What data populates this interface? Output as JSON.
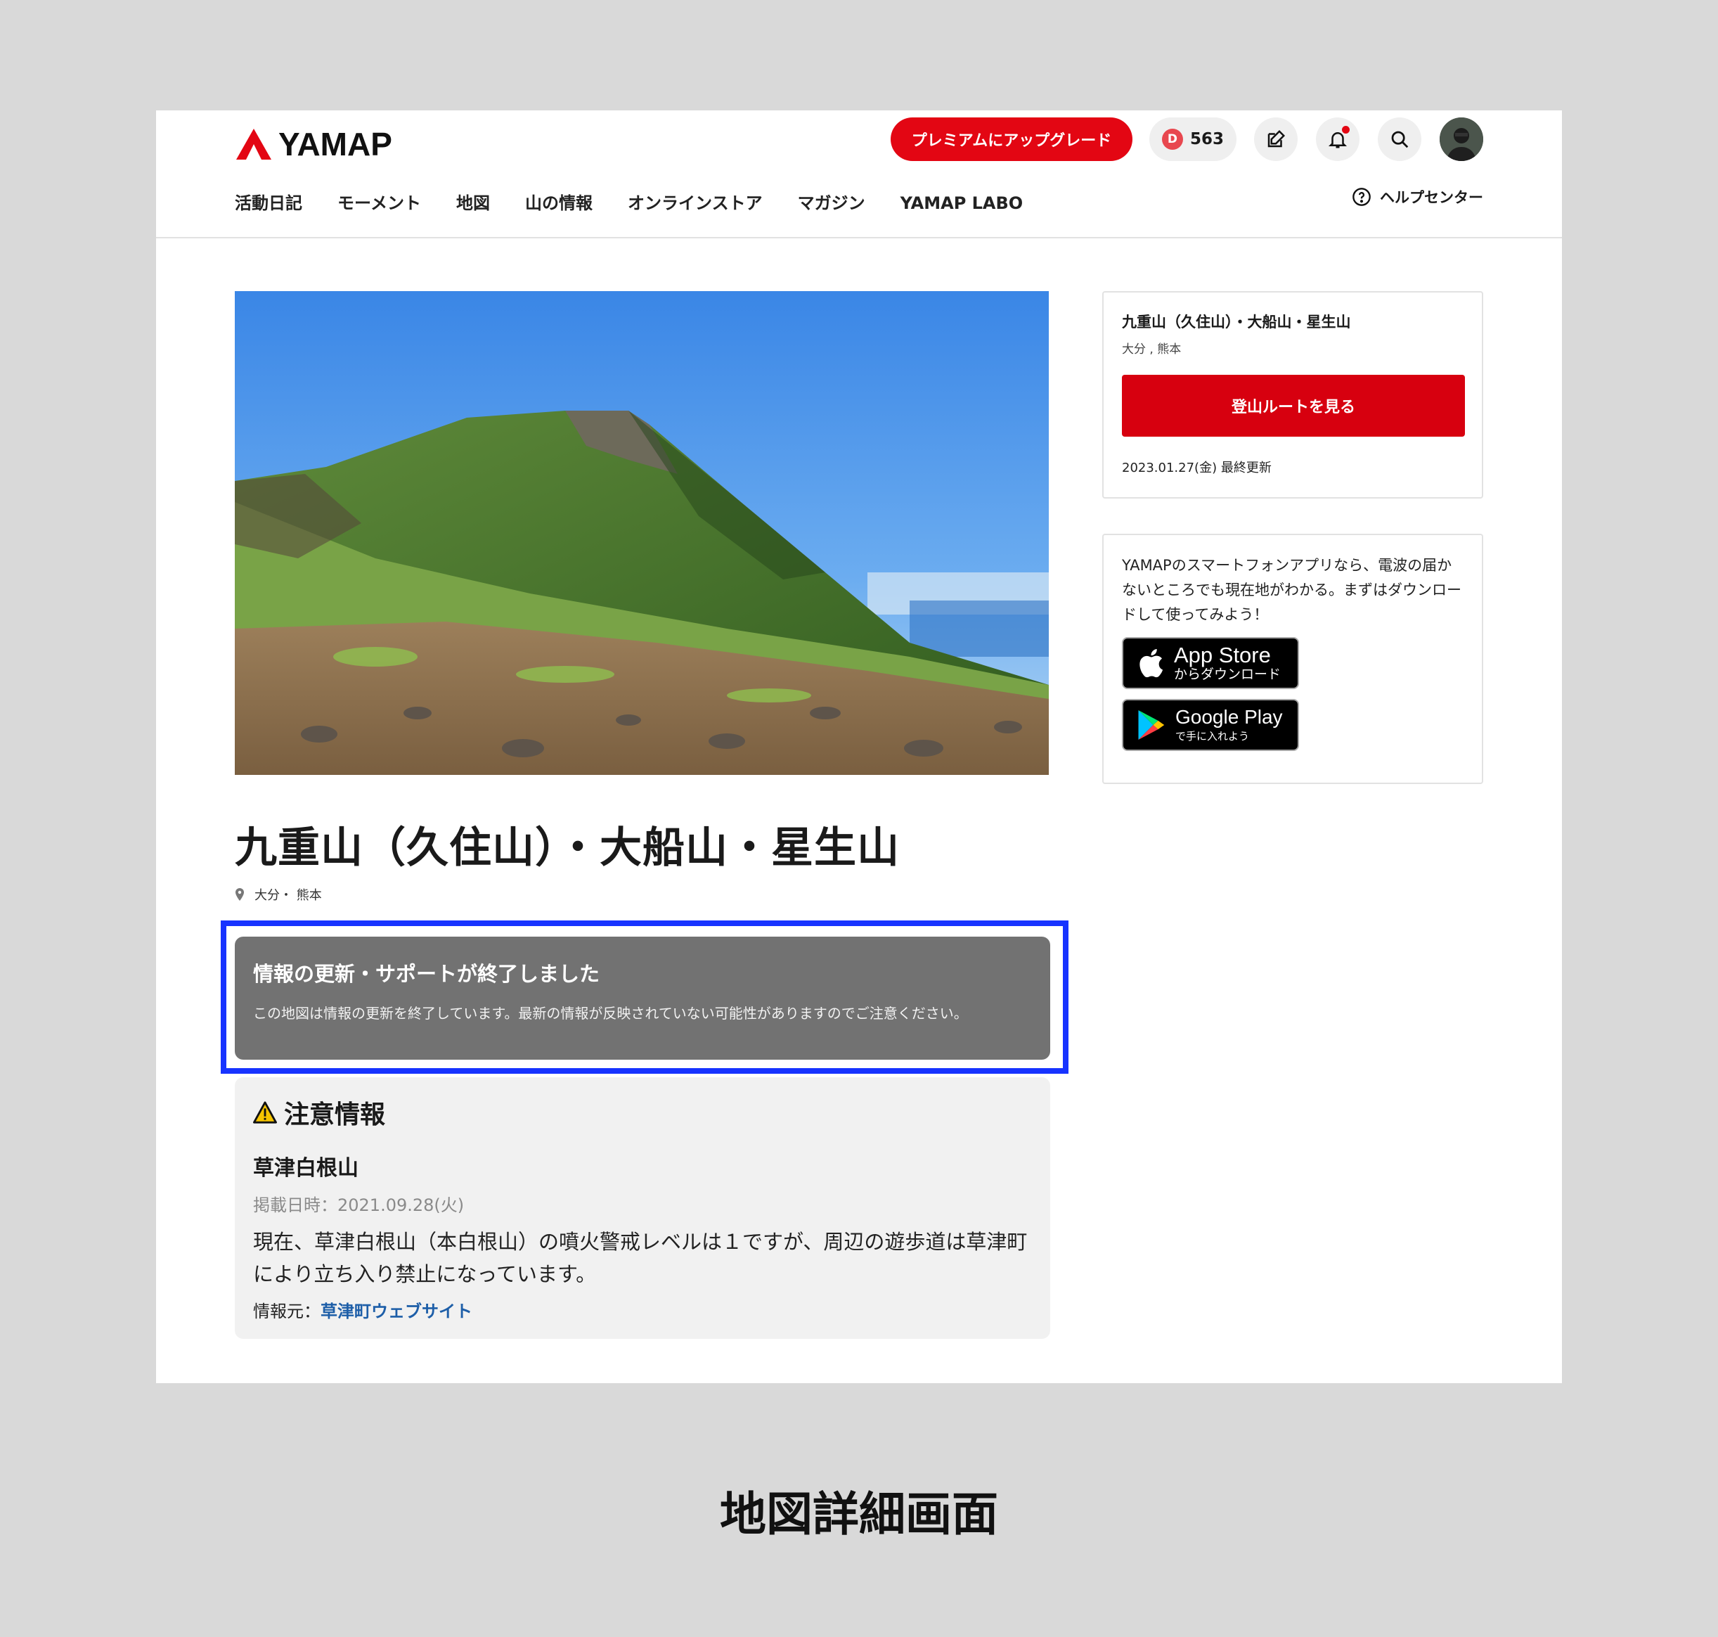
{
  "header": {
    "logo_text": "YAMAP",
    "premium_label": "プレミアムにアップグレード",
    "points_icon_letter": "D",
    "points_value": "563",
    "nav": [
      "活動日記",
      "モーメント",
      "地図",
      "山の情報",
      "オンラインストア",
      "マガジン",
      "YAMAP LABO"
    ],
    "help_label": "ヘルプセンター"
  },
  "main": {
    "title": "九重山（久住山）・大船山・星生山",
    "location": "大分・ 熊本",
    "notice": {
      "title": "情報の更新・サポートが終了しました",
      "body": "この地図は情報の更新を終了しています。最新の情報が反映されていない可能性がありますのでご注意ください。"
    },
    "caution": {
      "heading": "注意情報",
      "subtitle": "草津白根山",
      "date": "掲載日時：2021.09.28(火)",
      "text": "現在、草津白根山（本白根山）の噴火警戒レベルは１ですが、周辺の遊歩道は草津町により立ち入り禁止になっています。",
      "source_label": "情報元：",
      "source_link": "草津町ウェブサイト"
    }
  },
  "sidebar": {
    "card_title": "九重山（久住山）・大船山・星生山",
    "card_sub": "大分 , 熊本",
    "route_button": "登山ルートを見る",
    "updated": "2023.01.27(金) 最終更新",
    "app_text": "YAMAPのスマートフォンアプリなら、電波の届かないところでも現在地がわかる。まずはダウンロードして使ってみよう！",
    "appstore_main": "App Store",
    "appstore_sub": "からダウンロード",
    "googleplay_main": "Google Play",
    "googleplay_sub": "で手に入れよう"
  },
  "caption": "地図詳細画面",
  "colors": {
    "brand_red": "#e30613",
    "highlight_blue": "#1733ff",
    "notice_gray": "#727272",
    "link_blue": "#1d5ea8"
  }
}
